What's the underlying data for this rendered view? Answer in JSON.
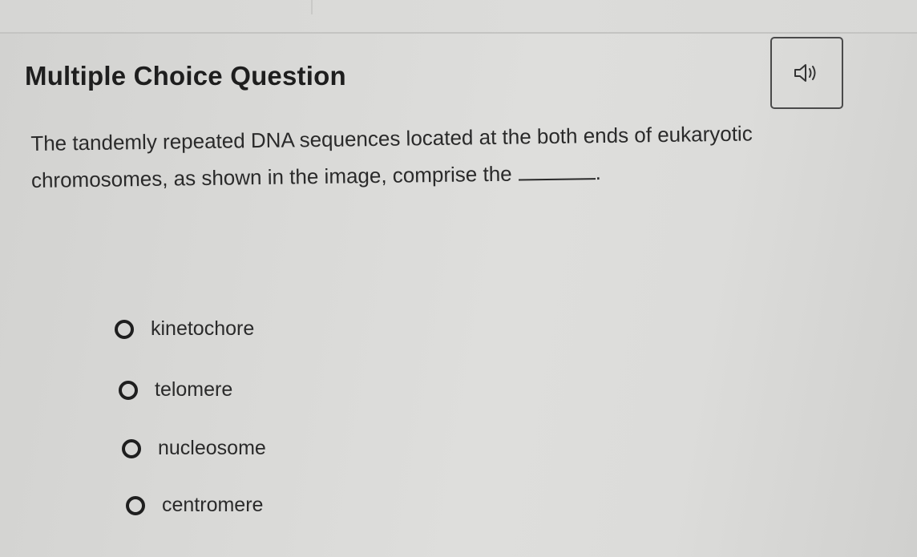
{
  "question": {
    "heading": "Multiple Choice Question",
    "text_line1": "The tandemly repeated DNA sequences located at the both ends of eukaryotic",
    "text_line2_before_blank": "chromosomes, as shown in the image, comprise the",
    "text_line2_after_blank": "."
  },
  "audio_button": {
    "icon": "speaker-icon"
  },
  "options": [
    {
      "label": "kinetochore",
      "selected": false
    },
    {
      "label": "telomere",
      "selected": false
    },
    {
      "label": "nucleosome",
      "selected": false
    },
    {
      "label": "centromere",
      "selected": false
    }
  ],
  "colors": {
    "text": "#2a2a2a",
    "heading": "#1e1e1e",
    "radio_border": "#1f1f1f",
    "button_border": "#4a4a4a"
  }
}
